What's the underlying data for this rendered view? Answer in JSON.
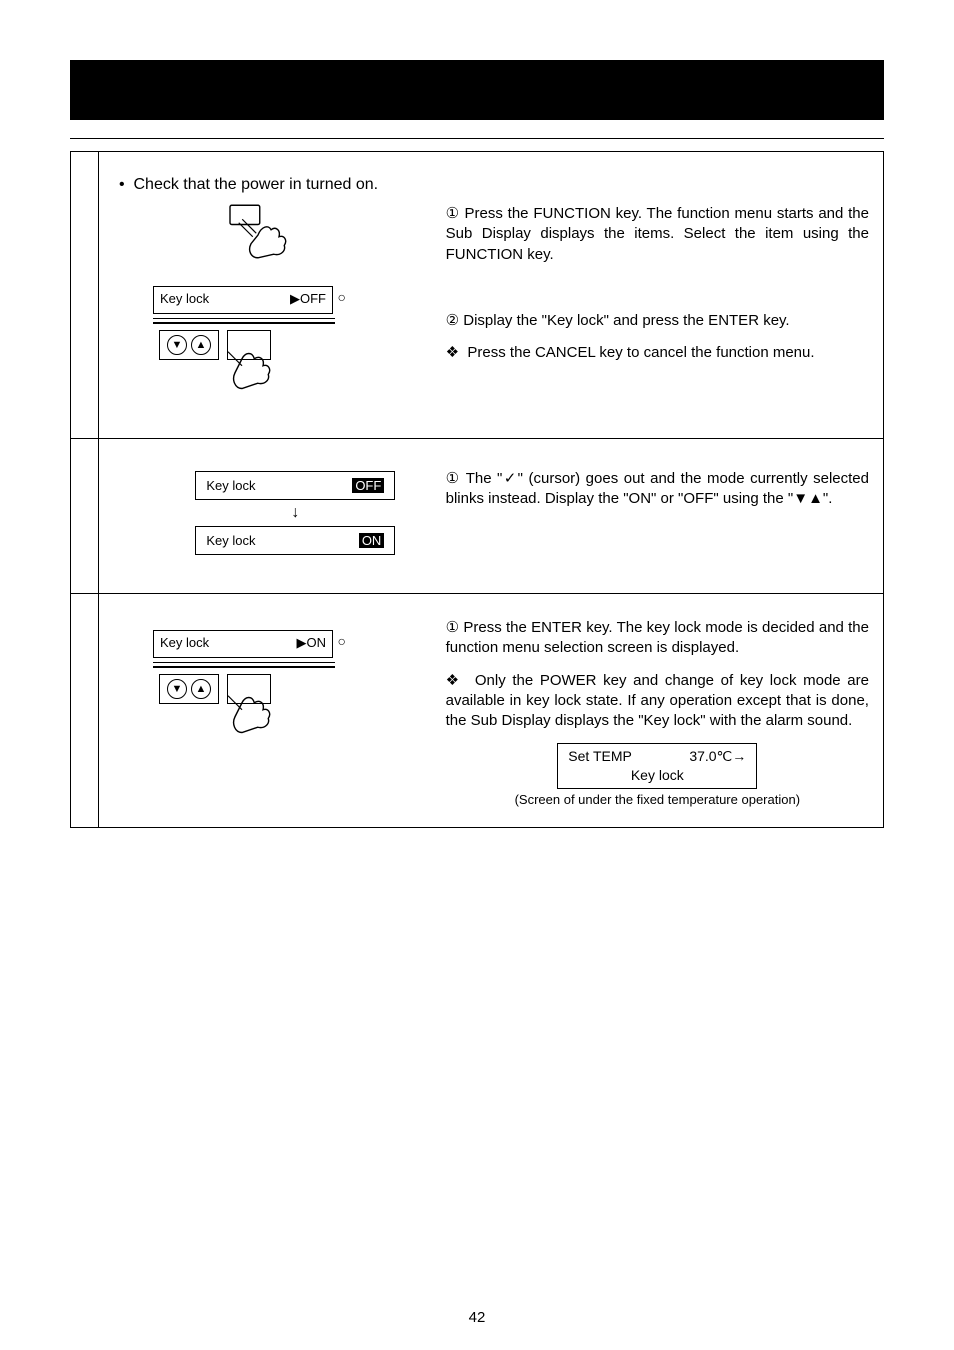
{
  "bullet_check_power": "Check that the power in turned on.",
  "s1": {
    "p1_num": "①",
    "p1": "Press the FUNCTION key.  The function menu starts and the Sub Display displays the items.  Select the item using the FUNCTION key.",
    "p2_num": "②",
    "p2": "Display the \"Key lock\" and press the ENTER key.",
    "p3_sym": "❖",
    "p3": "Press the CANCEL key to cancel the function menu.",
    "lcd_label": "Key lock",
    "lcd_val": "▶OFF",
    "led": "○"
  },
  "s2": {
    "p1_num": "①",
    "p1": "The \"✓\" (cursor) goes out and the mode currently selected blinks instead.  Display the \"ON\" or \"OFF\" using the \"▼▲\".",
    "lcd1_label": "Key lock",
    "lcd1_val": "OFF",
    "arrow": "↓",
    "lcd2_label": "Key lock",
    "lcd2_val": "ON"
  },
  "s3": {
    "p1_num": "①",
    "p1": "Press the ENTER key.  The key lock mode is decided and the function menu selection screen is displayed.",
    "p2_sym": "❖",
    "p2": "Only the POWER key and change of key lock mode are available in key lock state.  If any operation except that is done, the Sub Display displays the \"Key lock\" with the alarm sound.",
    "lcd_label": "Key lock",
    "lcd_val": "▶ON",
    "led": "○",
    "ex_lcd_l": "Set TEMP",
    "ex_lcd_r": "37.0℃→",
    "ex_lcd_row2": "Key lock",
    "ex_caption": "(Screen of under the fixed temperature operation)"
  },
  "page_number": "42"
}
